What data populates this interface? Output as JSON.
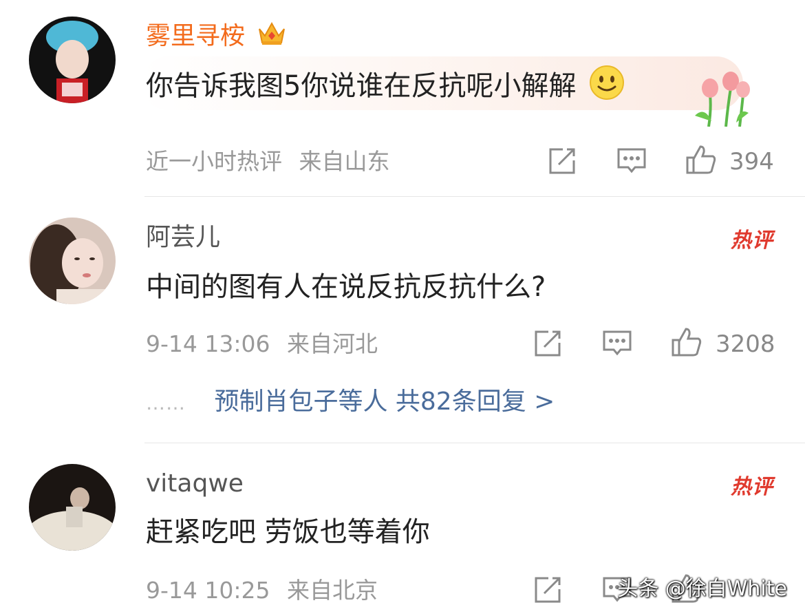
{
  "comments": [
    {
      "username": "雾里寻桉",
      "text": "你告诉我图5你说谁在反抗呢小解解",
      "time": "近一小时热评",
      "location": "来自山东",
      "likes": "394",
      "hot_badge": ""
    },
    {
      "username": "阿芸儿",
      "text": "中间的图有人在说反抗反抗什么?",
      "time": "9-14 13:06",
      "location": "来自河北",
      "likes": "3208",
      "hot_badge": "热评",
      "replies_dots": "……",
      "replies_link": "预制肖包子等人 共82条回复 >"
    },
    {
      "username": "vitaqwe",
      "text": "赶紧吃吧 劳饭也等着你",
      "time": "9-14 10:25",
      "location": "来自北京",
      "likes": "",
      "hot_badge": "热评"
    }
  ],
  "watermark": "头条 @徐白White",
  "icons": [
    "share-icon",
    "comment-icon",
    "like-icon",
    "crown-icon",
    "smiley-icon",
    "tulip-icon"
  ],
  "colors": {
    "vip_name": "#f36b1c",
    "hot_badge": "#e03a2e",
    "reply_link": "#4a6c9b",
    "meta": "#999999"
  }
}
